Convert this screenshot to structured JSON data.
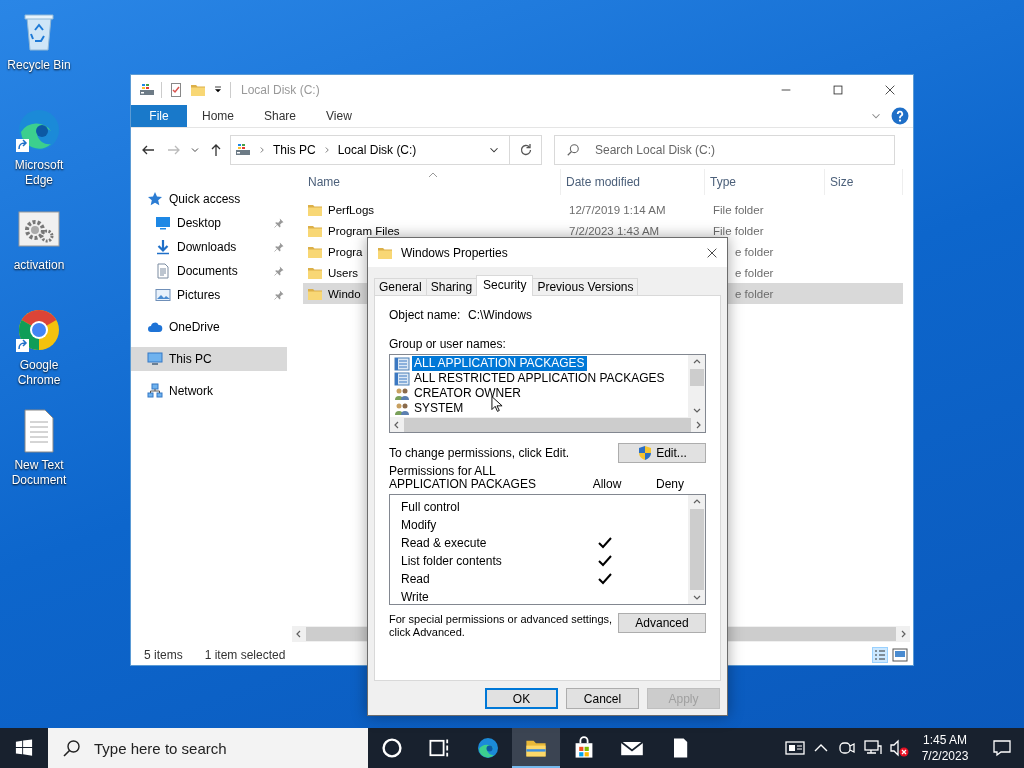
{
  "desktop_icons": [
    {
      "label": "Recycle Bin",
      "kind": "recycle"
    },
    {
      "label": "Microsoft Edge",
      "kind": "edge"
    },
    {
      "label": "activation",
      "kind": "gear"
    },
    {
      "label": "Google Chrome",
      "kind": "chrome"
    },
    {
      "label": "New Text Document",
      "kind": "textdoc"
    }
  ],
  "explorer": {
    "title": "Local Disk (C:)",
    "ribbon_tabs": [
      {
        "label": "File",
        "kind": "file"
      },
      {
        "label": "Home",
        "kind": "tab"
      },
      {
        "label": "Share",
        "kind": "tab"
      },
      {
        "label": "View",
        "kind": "tab"
      }
    ],
    "address": [
      "This PC",
      "Local Disk (C:)"
    ],
    "search": {
      "placeholder": "Search Local Disk (C:)"
    },
    "nav": [
      {
        "label": "Quick access",
        "kind": "star",
        "selected": false,
        "children": [
          {
            "label": "Desktop",
            "kind": "desktop",
            "pinned": true,
            "selected": false
          },
          {
            "label": "Downloads",
            "kind": "download",
            "pinned": true,
            "selected": false
          },
          {
            "label": "Documents",
            "kind": "documents",
            "pinned": true,
            "selected": false
          },
          {
            "label": "Pictures",
            "kind": "pictures",
            "pinned": true,
            "selected": false
          }
        ]
      },
      {
        "label": "OneDrive",
        "kind": "cloud",
        "selected": false
      },
      {
        "label": "This PC",
        "kind": "pc",
        "selected": true
      },
      {
        "label": "Network",
        "kind": "network",
        "selected": false
      }
    ],
    "columns": [
      {
        "label": "Name",
        "sorted": true
      },
      {
        "label": "Date modified",
        "sorted": false
      },
      {
        "label": "Type",
        "sorted": false
      },
      {
        "label": "Size",
        "sorted": false
      }
    ],
    "rows": [
      {
        "name": "PerfLogs",
        "date": "12/7/2019 1:14 AM",
        "type": "File folder",
        "selected": false
      },
      {
        "name": "Program Files",
        "date": "7/2/2023 1:43 AM",
        "type": "File folder",
        "selected": false
      },
      {
        "name": "Progra",
        "type": "e folder",
        "clipped": true,
        "selected": false
      },
      {
        "name": "Users",
        "type": "e folder",
        "clipped": true,
        "selected": false
      },
      {
        "name": "Windo",
        "type": "e folder",
        "clipped": true,
        "selected": true
      }
    ],
    "status": [
      "5 items",
      "1 item selected"
    ]
  },
  "dialog": {
    "title": "Windows Properties",
    "tabs": [
      {
        "label": "General",
        "selected": false
      },
      {
        "label": "Sharing",
        "selected": false
      },
      {
        "label": "Security",
        "selected": true
      },
      {
        "label": "Previous Versions",
        "selected": false
      }
    ],
    "object_label": "Object name:",
    "object_value": "C:\\Windows",
    "groups_label": "Group or user names:",
    "groups": [
      {
        "name": "ALL APPLICATION PACKAGES",
        "kind": "package",
        "selected": true
      },
      {
        "name": "ALL RESTRICTED APPLICATION PACKAGES",
        "kind": "package",
        "selected": false
      },
      {
        "name": "CREATOR OWNER",
        "kind": "users",
        "selected": false
      },
      {
        "name": "SYSTEM",
        "kind": "users",
        "selected": false
      }
    ],
    "change_hint": "To change permissions, click Edit.",
    "edit_button": "Edit...",
    "permissions_label": "Permissions for ALL APPLICATION PACKAGES",
    "allow_label": "Allow",
    "deny_label": "Deny",
    "permissions": [
      {
        "name": "Full control",
        "allow": false,
        "deny": false
      },
      {
        "name": "Modify",
        "allow": false,
        "deny": false
      },
      {
        "name": "Read & execute",
        "allow": true,
        "deny": false
      },
      {
        "name": "List folder contents",
        "allow": true,
        "deny": false
      },
      {
        "name": "Read",
        "allow": true,
        "deny": false
      },
      {
        "name": "Write",
        "allow": false,
        "deny": false
      }
    ],
    "advanced_hint": "For special permissions or advanced settings, click Advanced.",
    "advanced_button": "Advanced",
    "buttons": [
      {
        "label": "OK",
        "kind": "default",
        "disabled": false
      },
      {
        "label": "Cancel",
        "kind": "normal",
        "disabled": false
      },
      {
        "label": "Apply",
        "kind": "normal",
        "disabled": true
      }
    ]
  },
  "taskbar": {
    "search_placeholder": "Type here to search",
    "apps": [
      {
        "kind": "cortana",
        "active": false
      },
      {
        "kind": "taskview",
        "active": false
      },
      {
        "kind": "edge",
        "active": false
      },
      {
        "kind": "explorer",
        "active": true
      },
      {
        "kind": "store",
        "active": false
      },
      {
        "kind": "mail",
        "active": false
      },
      {
        "kind": "notepad",
        "active": false
      }
    ],
    "tray": [
      {
        "kind": "news"
      },
      {
        "kind": "chevron"
      },
      {
        "kind": "meet"
      },
      {
        "kind": "network"
      },
      {
        "kind": "volume_muted"
      }
    ],
    "time": "1:45 AM",
    "date": "7/2/2023"
  }
}
